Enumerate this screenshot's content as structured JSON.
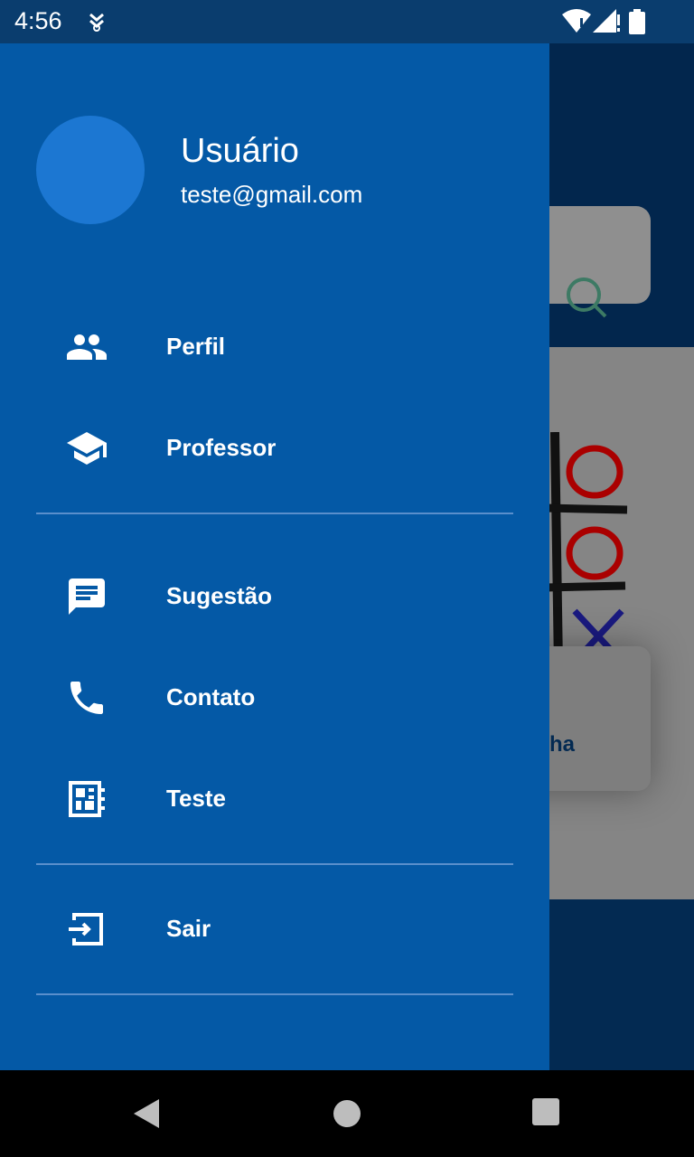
{
  "status_bar": {
    "time": "4:56",
    "icons": [
      "notification-icon",
      "wifi-icon",
      "signal-icon",
      "battery-icon"
    ]
  },
  "background_app": {
    "card_text": "ha"
  },
  "drawer": {
    "user": {
      "name": "Usuário",
      "email": "teste@gmail.com"
    },
    "items": [
      {
        "label": "Perfil",
        "icon": "people-icon"
      },
      {
        "label": "Professor",
        "icon": "school-icon"
      },
      {
        "label": "Sugestão",
        "icon": "comment-icon"
      },
      {
        "label": "Contato",
        "icon": "phone-icon"
      },
      {
        "label": "Teste",
        "icon": "dashboard-icon"
      },
      {
        "label": "Sair",
        "icon": "logout-icon"
      }
    ]
  },
  "colors": {
    "drawer_bg": "#0459a6",
    "avatar": "#1c77d2",
    "status_bar": "#0a3d6e"
  }
}
